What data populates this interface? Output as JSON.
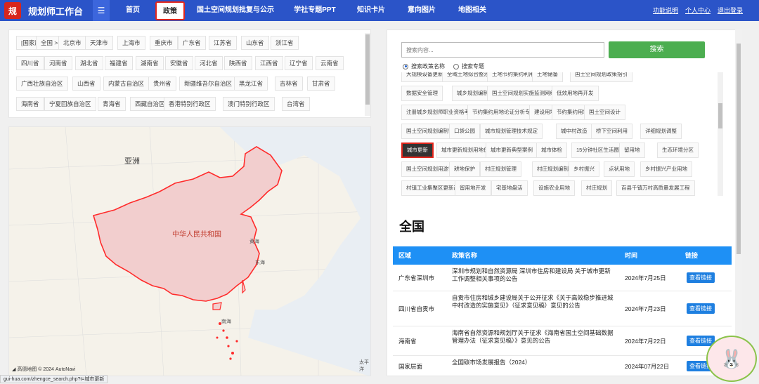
{
  "brand": {
    "logo_glyph": "规",
    "name": "规划师工作台",
    "menu_glyph": "☰"
  },
  "nav": {
    "items": [
      {
        "label": "首页"
      },
      {
        "label": "政策"
      },
      {
        "label": "国土空间规划批复与公示"
      },
      {
        "label": "学社专题PPT"
      },
      {
        "label": "知识卡片"
      },
      {
        "label": "意向图片"
      },
      {
        "label": "地图相关"
      }
    ],
    "right": [
      {
        "label": "功能说明"
      },
      {
        "label": "个人中心"
      },
      {
        "label": "退出登录"
      }
    ]
  },
  "regions": [
    "[国家层面]",
    "全国 >",
    "北京市",
    "天津市",
    "上海市",
    "重庆市",
    "广东省",
    "江苏省",
    "山东省",
    "浙江省",
    "四川省",
    "河南省",
    "湖北省",
    "福建省",
    "湖南省",
    "安徽省",
    "河北省",
    "陕西省",
    "江西省",
    "辽宁省",
    "云南省",
    "广西壮族自治区",
    "山西省",
    "内蒙古自治区",
    "贵州省",
    "新疆维吾尔自治区",
    "黑龙江省",
    "吉林省",
    "甘肃省",
    "海南省",
    "宁夏回族自治区",
    "青海省",
    "西藏自治区",
    "香港特别行政区",
    "澳门特别行政区",
    "台湾省"
  ],
  "map": {
    "asia": "亚洲",
    "country": "中华人民共和国",
    "labels": {
      "huanghai": "黄海",
      "donghai": "东海",
      "nanhai": "南海",
      "pacific": "太平洋"
    },
    "footer": "高德地图 © 2024 AutoNavi",
    "colors": {
      "land": "#f5f2ea",
      "fill": "#f2cece",
      "border": "#ff2b2b"
    }
  },
  "url_status": "gui-hua.com/zhengce_search.php?t=城市更新",
  "search": {
    "placeholder": "搜索内容...",
    "button": "搜索",
    "options": [
      "搜索政策名称",
      "搜索专题"
    ],
    "selected": 0
  },
  "tags": [
    "大规模设备更新和消费品以旧换新",
    "全域土地综合整治",
    "土地节约集约利用",
    "土地储备",
    "国土空间规划政策指引",
    "数据安全管理",
    "城乡规划编制单位资质",
    "国土空间规划实施监测网络建设",
    "低效用地再开发",
    "注册城乡规划师职业资格考试",
    "节约集约用地论证分析专章",
    "建设用地管理",
    "节约集约用地",
    "国土空间设计",
    "国土空间规划编制管理",
    "口袋公园",
    "城市规划管理技术规定",
    "城中村改造",
    "桥下空间利用",
    "详细规划调整",
    "城市更新",
    "城市更新规划用地保障",
    "城市更新典型案例",
    "城市体检",
    "15分钟社区生活圈",
    "留用地",
    "生态环境分区",
    "国土空间规划用途管制",
    "耕地保护",
    "村庄规划管理",
    "村庄规划编制",
    "乡村振兴",
    "点状用地",
    "乡村振兴产业用地",
    "村镇工业集聚区更新改造",
    "留用地开发",
    "宅基地盘活",
    "设施农业用地",
    "村庄规划",
    "百县千镇万村高质量发展工程"
  ],
  "active_tag": "城市更新",
  "section_title": "全国",
  "table": {
    "headers": [
      "区域",
      "政策名称",
      "时间",
      "链接"
    ],
    "rows": [
      {
        "region": "广东省深圳市",
        "title": "深圳市规划和自然资源局 深圳市住房和建设局 关于城市更新工作调整相关事项的公告",
        "date": "2024年7月25日",
        "link": "查看链接"
      },
      {
        "region": "四川省自贡市",
        "title": "自贡市住房和城乡建设局关于公开征求《关于高效稳步推进城中村改造的实施意见》（征求意见稿）意见的公告",
        "date": "2024年7月23日",
        "link": "查看链接"
      },
      {
        "region": "海南省",
        "title": "海南省自然资源和规划厅关于征求《海南省国土空间基础数据管理办法（征求意见稿）》意见的公告",
        "date": "2024年7月22日",
        "link": "查看链接"
      },
      {
        "region": "国家层面",
        "title": "全国碳市场发展报告（2024）",
        "date": "2024年07月22日",
        "link": "查看链接"
      }
    ]
  },
  "colors": {
    "nav": "#2b54c8",
    "accent_red": "#e2261c",
    "search_green": "#4cae50",
    "table_head": "#1e90f5"
  }
}
